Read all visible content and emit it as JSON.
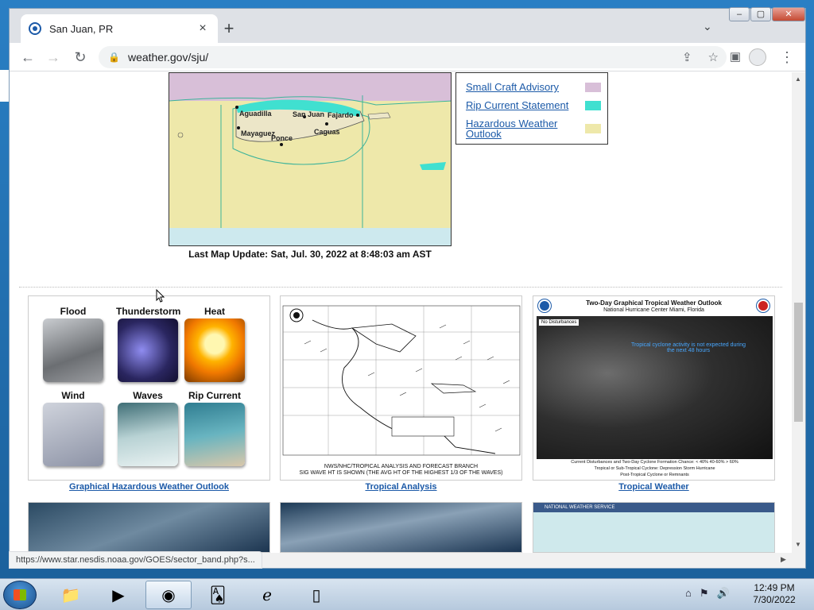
{
  "browser": {
    "tab_title": "San Juan, PR",
    "tab_close": "×",
    "new_tab": "+",
    "tab_menu": "⌄",
    "url": "weather.gov/sju/",
    "status_url": "https://www.star.nesdis.noaa.gov/GOES/sector_band.php?s..."
  },
  "window_controls": {
    "minimize": "–",
    "maximize": "▢",
    "close": "✕"
  },
  "map": {
    "labels": [
      "Aguadilla",
      "San Juan",
      "Fajardo",
      "Mayaguez",
      "Ponce",
      "Caguas"
    ],
    "last_update": "Last Map Update: Sat, Jul. 30, 2022 at 8:48:03 am AST"
  },
  "legend": {
    "items": [
      {
        "label": "Small Craft Advisory",
        "color": "#d8bfd8"
      },
      {
        "label": "Rip Current Statement",
        "color": "#40e0d0"
      },
      {
        "label": "Hazardous Weather Outlook",
        "color": "#eee8aa"
      }
    ]
  },
  "hazards": {
    "cells": [
      {
        "label": "Flood"
      },
      {
        "label": "Thunderstorm"
      },
      {
        "label": "Heat"
      },
      {
        "label": "Wind"
      },
      {
        "label": "Waves"
      },
      {
        "label": "Rip Current"
      }
    ],
    "link": "Graphical Hazardous Weather Outlook"
  },
  "tropical_analysis": {
    "caption_line1": "NWS/NHC/TROPICAL ANALYSIS AND FORECAST BRANCH",
    "caption_line2": "SIG WAVE HT IS SHOWN (THE AVG HT OF THE HIGHEST 1/3 OF THE WAVES)",
    "link": "Tropical Analysis"
  },
  "tropical_weather": {
    "title": "Two-Day Graphical Tropical Weather Outlook",
    "subtitle": "National Hurricane Center  Miami, Florida",
    "badge": "No Disturbances",
    "note": "Tropical cyclone activity is not expected during the next 48 hours",
    "foot1": "Current Disturbances and Two-Day Cyclone Formation Chance:  < 40%  40-60%  > 60%",
    "foot2": "Tropical or Sub-Tropical Cyclone:  Depression  Storm  Hurricane",
    "foot3": "Post-Tropical Cyclone or Remnants",
    "link": "Tropical Weather"
  },
  "nws_banner": "NATIONAL WEATHER SERVICE",
  "taskbar": {
    "time": "12:49 PM",
    "date": "7/30/2022"
  }
}
